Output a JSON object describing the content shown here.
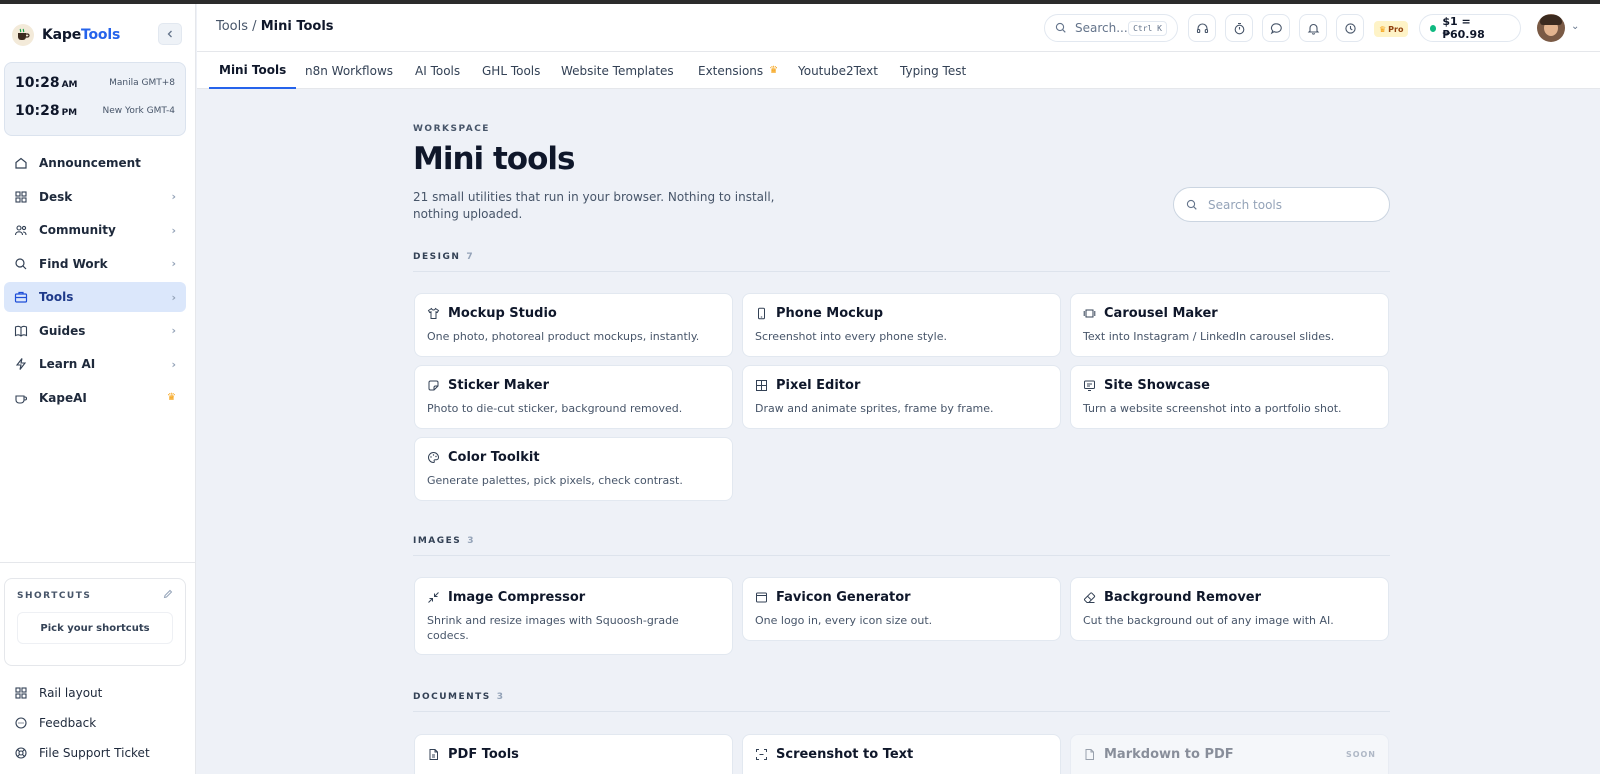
{
  "app": {
    "brand_prefix": "Kape",
    "brand_suffix": "Tools"
  },
  "clocks": [
    {
      "time": "10:28",
      "ampm": "AM",
      "zone": "Manila GMT+8"
    },
    {
      "time": "10:28",
      "ampm": "PM",
      "zone": "New York GMT-4"
    }
  ],
  "nav": {
    "items": [
      {
        "label": "Announcement"
      },
      {
        "label": "Desk"
      },
      {
        "label": "Community"
      },
      {
        "label": "Find Work"
      },
      {
        "label": "Tools"
      },
      {
        "label": "Guides"
      },
      {
        "label": "Learn AI"
      },
      {
        "label": "KapeAI"
      }
    ]
  },
  "shortcuts": {
    "title": "SHORTCUTS",
    "pick_label": "Pick your shortcuts"
  },
  "bottom_nav": [
    {
      "label": "Rail layout"
    },
    {
      "label": "Feedback"
    },
    {
      "label": "File Support Ticket"
    }
  ],
  "topbar": {
    "breadcrumb_parent": "Tools",
    "breadcrumb_sep": " / ",
    "breadcrumb_current": "Mini Tools",
    "search_placeholder": "Search...",
    "search_kbd": "Ctrl K",
    "pro_label": "Pro",
    "rate_text": "$1 = ₱60.98"
  },
  "tabs": [
    {
      "label": "Mini Tools"
    },
    {
      "label": "n8n Workflows"
    },
    {
      "label": "AI Tools"
    },
    {
      "label": "GHL Tools"
    },
    {
      "label": "Website Templates"
    },
    {
      "label": "Extensions"
    },
    {
      "label": "Youtube2Text"
    },
    {
      "label": "Typing Test"
    }
  ],
  "header": {
    "eyebrow": "WORKSPACE",
    "title": "Mini tools",
    "subtitle": "21 small utilities that run in your browser. Nothing to install, nothing uploaded.",
    "search_placeholder": "Search tools"
  },
  "sections": [
    {
      "label": "DESIGN",
      "count": "7",
      "tools": [
        {
          "title": "Mockup Studio",
          "desc": "One photo, photoreal product mockups, instantly.",
          "icon": "shirt-icon"
        },
        {
          "title": "Phone Mockup",
          "desc": "Screenshot into every phone style.",
          "icon": "phone-icon"
        },
        {
          "title": "Carousel Maker",
          "desc": "Text into Instagram / LinkedIn carousel slides.",
          "icon": "carousel-icon"
        },
        {
          "title": "Sticker Maker",
          "desc": "Photo to die-cut sticker, background removed.",
          "icon": "sticker-icon"
        },
        {
          "title": "Pixel Editor",
          "desc": "Draw and animate sprites, frame by frame.",
          "icon": "grid-icon"
        },
        {
          "title": "Site Showcase",
          "desc": "Turn a website screenshot into a portfolio shot.",
          "icon": "showcase-icon"
        },
        {
          "title": "Color Toolkit",
          "desc": "Generate palettes, pick pixels, check contrast.",
          "icon": "palette-icon"
        }
      ]
    },
    {
      "label": "IMAGES",
      "count": "3",
      "tools": [
        {
          "title": "Image Compressor",
          "desc": "Shrink and resize images with Squoosh-grade codecs.",
          "icon": "compress-icon"
        },
        {
          "title": "Favicon Generator",
          "desc": "One logo in, every icon size out.",
          "icon": "window-icon"
        },
        {
          "title": "Background Remover",
          "desc": "Cut the background out of any image with AI.",
          "icon": "eraser-icon"
        }
      ]
    },
    {
      "label": "DOCUMENTS",
      "count": "3",
      "tools": [
        {
          "title": "PDF Tools",
          "desc": "",
          "icon": "pdf-icon"
        },
        {
          "title": "Screenshot to Text",
          "desc": "",
          "icon": "scan-icon"
        },
        {
          "title": "Markdown to PDF",
          "desc": "",
          "icon": "doc-icon",
          "badge": "SOON"
        }
      ]
    }
  ],
  "colors": {
    "accent": "#2563eb",
    "active_nav_bg": "#dbe7fb",
    "crown": "#f59e0b",
    "status_green": "#10b981"
  }
}
